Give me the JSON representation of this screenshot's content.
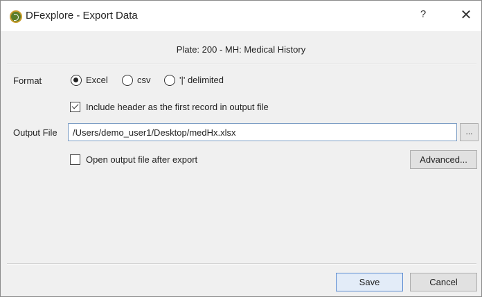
{
  "window": {
    "title": "DFexplore - Export Data",
    "help_label": "?",
    "close_label": "✕"
  },
  "plate_label": "Plate: 200 - MH: Medical History",
  "format": {
    "label": "Format",
    "options": [
      {
        "label": "Excel",
        "selected": true
      },
      {
        "label": "csv",
        "selected": false
      },
      {
        "label": "'|' delimited",
        "selected": false
      }
    ]
  },
  "include_header": {
    "label": "Include header as the first record in output file",
    "checked": true
  },
  "output_file": {
    "label": "Output File",
    "value": "/Users/demo_user1/Desktop/medHx.xlsx",
    "browse_label": "..."
  },
  "open_after_export": {
    "label": "Open output file after export",
    "checked": false
  },
  "buttons": {
    "advanced": "Advanced...",
    "save": "Save",
    "cancel": "Cancel"
  }
}
